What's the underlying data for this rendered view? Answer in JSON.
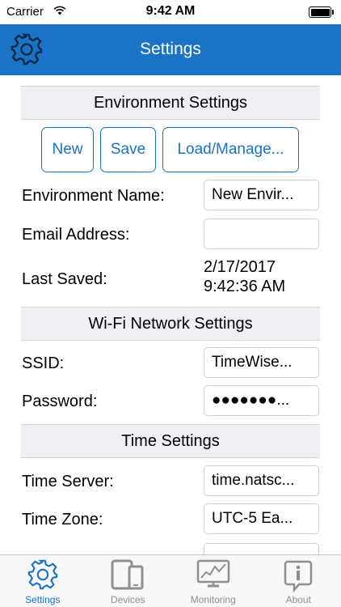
{
  "status_bar": {
    "carrier": "Carrier",
    "time": "9:42 AM",
    "battery_level": 1.0
  },
  "nav": {
    "title": "Settings",
    "icon": "gear-icon"
  },
  "environment": {
    "header": "Environment Settings",
    "buttons": {
      "new": "New",
      "save": "Save",
      "load": "Load/Manage..."
    },
    "name_label": "Environment Name:",
    "name_value": "New Envir...",
    "email_label": "Email Address:",
    "email_value": "",
    "last_saved_label": "Last Saved:",
    "last_saved_date": "2/17/2017",
    "last_saved_time": "9:42:36 AM"
  },
  "wifi": {
    "header": "Wi-Fi Network Settings",
    "ssid_label": "SSID:",
    "ssid_value": "TimeWise...",
    "password_label": "Password:",
    "password_value": "●●●●●●●..."
  },
  "time": {
    "header": "Time Settings",
    "server_label": "Time Server:",
    "server_value": "time.natsc...",
    "zone_label": "Time Zone:",
    "zone_value": "UTC-5 Ea..."
  },
  "tabs": [
    {
      "label": "Settings",
      "icon": "gear-icon",
      "active": true
    },
    {
      "label": "Devices",
      "icon": "devices-icon",
      "active": false
    },
    {
      "label": "Monitoring",
      "icon": "monitoring-icon",
      "active": false
    },
    {
      "label": "About",
      "icon": "info-icon",
      "active": false
    }
  ],
  "colors": {
    "accent": "#1a73c6",
    "section_bg": "#efeff4",
    "inactive_tab": "#8e8e93"
  }
}
